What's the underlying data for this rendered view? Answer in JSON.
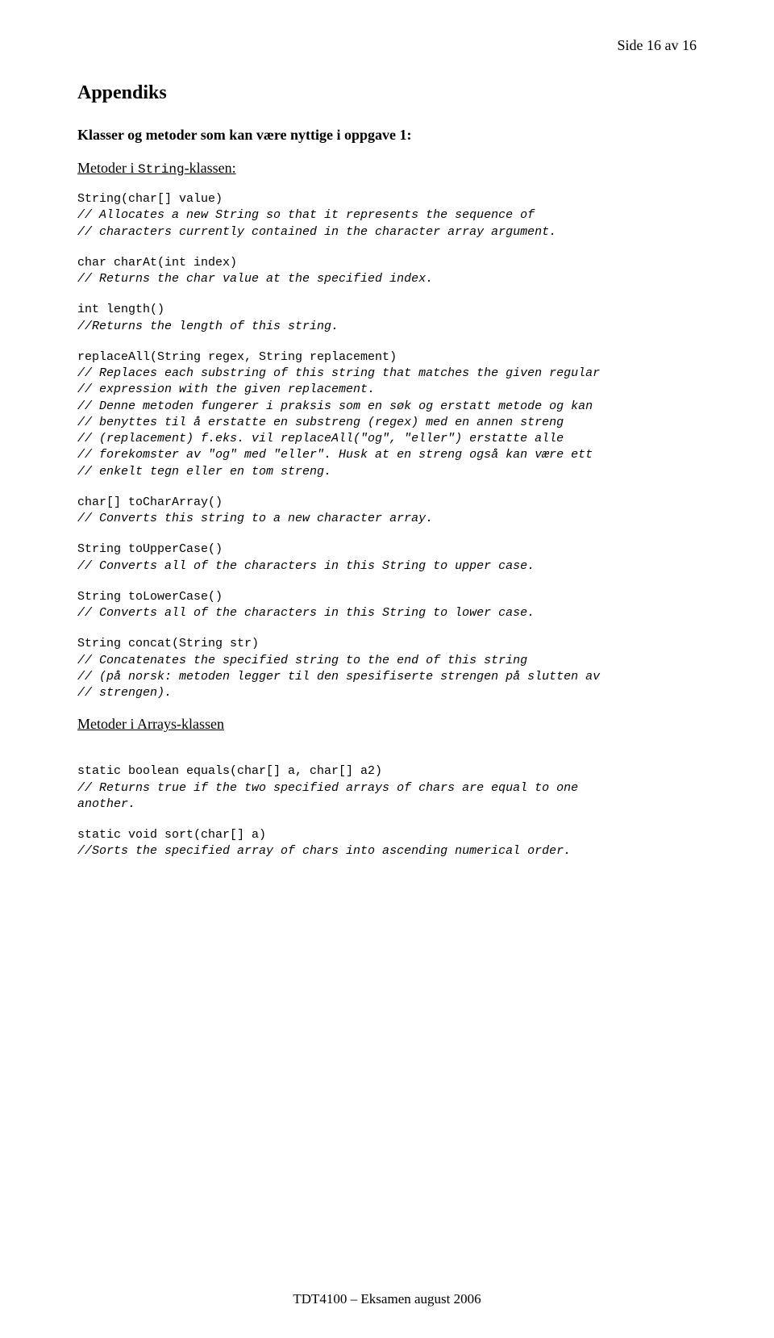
{
  "header": {
    "page_number": "Side 16 av 16"
  },
  "title": "Appendiks",
  "subheading": "Klasser og metoder som kan være nyttige i oppgave 1:",
  "string_section": {
    "link_prefix": "Metoder i ",
    "link_code": "String",
    "link_suffix": "-klassen:"
  },
  "entries": {
    "e1_sig": "String(char[] value)",
    "e1_c1": "// Allocates a new String so that it represents the sequence of",
    "e1_c2": "// characters currently contained in the character array argument.",
    "e2_sig": "char charAt(int index)",
    "e2_c1": "// Returns the char value at the specified index.",
    "e3_sig": "int length()",
    "e3_c1": "//Returns the length of this string.",
    "e4_sig": "replaceAll(String regex, String replacement)",
    "e4_c1": "// Replaces each substring of this string that matches the given regular",
    "e4_c2": "// expression with the given replacement.",
    "e4_c3": "// Denne metoden fungerer i praksis som en søk og erstatt metode og kan",
    "e4_c4": "// benyttes til å erstatte en substreng (regex) med en annen streng",
    "e4_c5": "// (replacement) f.eks. vil replaceAll(\"og\", \"eller\") erstatte alle",
    "e4_c6": "// forekomster av \"og\" med \"eller\". Husk at en streng også kan være ett",
    "e4_c7": "// enkelt tegn eller en tom streng.",
    "e5_sig": "char[] toCharArray()",
    "e5_c1": "// Converts this string to a new character array.",
    "e6_sig": "String toUpperCase()",
    "e6_c1": "// Converts all of the characters in this String to upper case.",
    "e7_sig": "String toLowerCase()",
    "e7_c1": "// Converts all of the characters in this String to lower case.",
    "e8_sig": "String concat(String str)",
    "e8_c1": "// Concatenates the specified string to the end of this string",
    "e8_c2": "// (på norsk: metoden legger til den spesifiserte strengen på slutten av",
    "e8_c3": "// strengen)."
  },
  "arrays_section": {
    "link": "Metoder i Arrays-klassen"
  },
  "arrays_entries": {
    "a1_sig": "static boolean equals(char[] a, char[] a2)",
    "a1_c1": "// Returns true if the two specified arrays of chars are equal to one",
    "a1_c2": "another.",
    "a2_sig": "static void sort(char[] a)",
    "a2_c1": "//Sorts the specified array of chars into ascending numerical order."
  },
  "footer": "TDT4100 – Eksamen august 2006"
}
